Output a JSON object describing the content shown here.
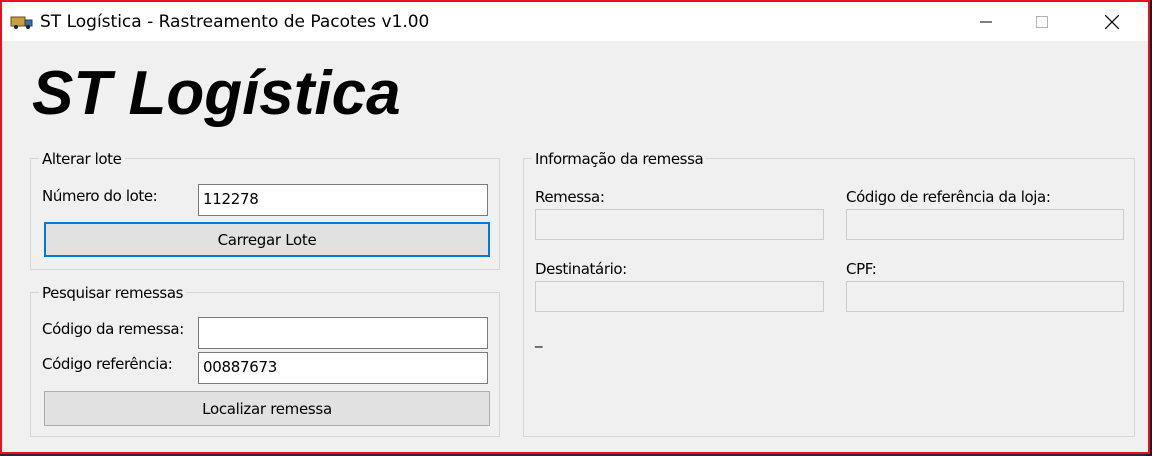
{
  "window": {
    "title": "ST Logística - Rastreamento de Pacotes v1.00",
    "app_icon": "truck-icon",
    "controls": [
      "minimize-icon",
      "maximize-icon",
      "close-icon"
    ]
  },
  "header": {
    "brand": "ST Logística"
  },
  "alterar_lote": {
    "legend": "Alterar lote",
    "numero_label": "Número do lote:",
    "numero_value": "112278",
    "load_button": "Carregar Lote"
  },
  "pesquisar": {
    "legend": "Pesquisar remessas",
    "codigo_remessa_label": "Código da remessa:",
    "codigo_remessa_value": "",
    "codigo_ref_label": "Código referência:",
    "codigo_ref_value": "00887673",
    "search_button": "Localizar remessa"
  },
  "info": {
    "legend": "Informação da remessa",
    "remessa_label": "Remessa:",
    "remessa_value": "",
    "codigo_loja_label": "Código de referência da loja:",
    "codigo_loja_value": "",
    "destinatario_label": "Destinatário:",
    "destinatario_value": "",
    "cpf_label": "CPF:",
    "cpf_value": "",
    "status_text": "_"
  },
  "colors": {
    "window_border": "#e81123",
    "focus_accent": "#0078d7",
    "form_background": "#f0f0f0"
  }
}
